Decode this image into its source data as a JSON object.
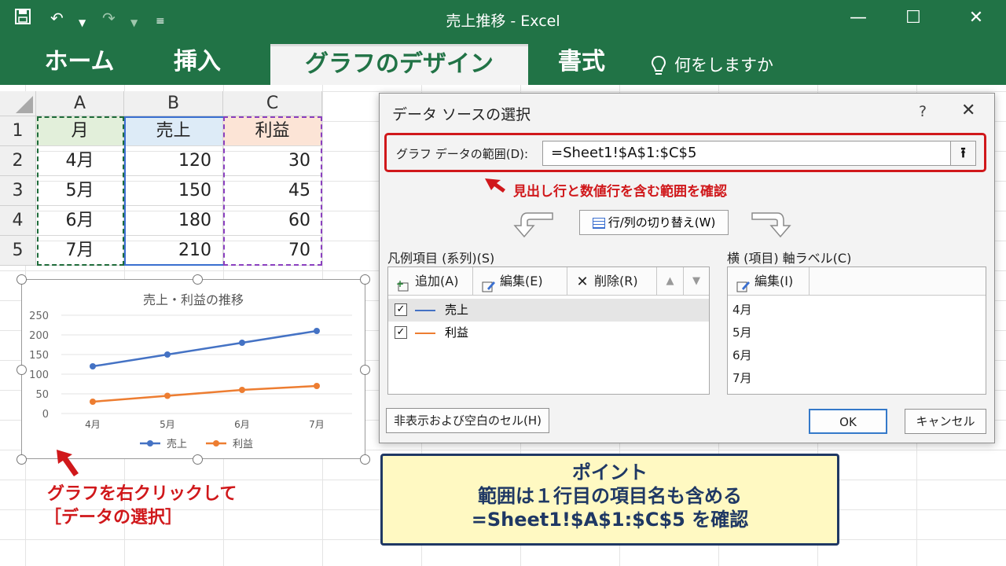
{
  "window": {
    "title": "売上推移 - Excel"
  },
  "ribbon": {
    "tabs": [
      {
        "label": "ホーム",
        "active": false
      },
      {
        "label": "挿入",
        "active": false
      },
      {
        "label": "グラフのデザイン",
        "active": true
      },
      {
        "label": "書式",
        "active": false
      }
    ],
    "tell_me": "何をしますか"
  },
  "sheet": {
    "columns": [
      "A",
      "B",
      "C"
    ],
    "rows": [
      "1",
      "2",
      "3",
      "4",
      "5"
    ],
    "headers": [
      "月",
      "売上",
      "利益"
    ],
    "data": [
      [
        "4月",
        "120",
        "30"
      ],
      [
        "5月",
        "150",
        "45"
      ],
      [
        "6月",
        "180",
        "60"
      ],
      [
        "7月",
        "210",
        "70"
      ]
    ]
  },
  "chart_data": {
    "type": "line",
    "title": "売上・利益の推移",
    "categories": [
      "4月",
      "5月",
      "6月",
      "7月"
    ],
    "series": [
      {
        "name": "売上",
        "values": [
          120,
          150,
          180,
          210
        ],
        "color": "#4472c4"
      },
      {
        "name": "利益",
        "values": [
          30,
          45,
          60,
          70
        ],
        "color": "#ed7d31"
      }
    ],
    "ylim": [
      0,
      250
    ],
    "yticks": [
      "250",
      "200",
      "150",
      "100",
      "50",
      "0"
    ],
    "legend": "bottom",
    "grid": true
  },
  "dialog": {
    "title": "データ ソースの選択",
    "help": "?",
    "close": "✕",
    "range_label": "グラフ データの範囲(D):",
    "range_value": "=Sheet1!$A$1:$C$5",
    "range_annotation": "見出し行と数値行を含む範囲を確認",
    "switch_label": "行/列の切り替え(W)",
    "legend_group_label": "凡例項目 (系列)(S)",
    "add_label": "追加(A)",
    "edit_label": "編集(E)",
    "delete_label": "削除(R)",
    "series": [
      {
        "name": "売上",
        "checked": true,
        "color": "#4472c4"
      },
      {
        "name": "利益",
        "checked": true,
        "color": "#ed7d31"
      }
    ],
    "axis_group_label": "横 (項目) 軸ラベル(C)",
    "axis_edit_label": "編集(I)",
    "axis_labels": [
      "4月",
      "5月",
      "6月",
      "7月"
    ],
    "hidden_cells_label": "非表示および空白のセル(H)",
    "ok_label": "OK",
    "cancel_label": "キャンセル"
  },
  "annotations": {
    "right_click_line1": "グラフを右クリックして",
    "right_click_line2": "［データの選択］",
    "point_line1": "ポイント",
    "point_line2": "範囲は１行目の項目名も含める",
    "point_line3": "=Sheet1!$A$1:$C$5 を確認"
  }
}
